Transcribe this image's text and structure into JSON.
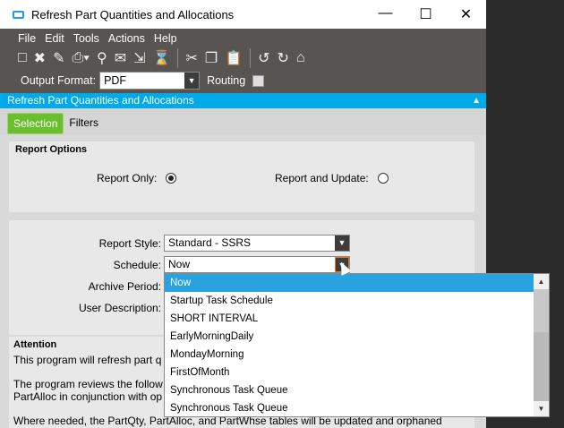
{
  "window": {
    "title": "Refresh Part Quantities and Allocations"
  },
  "menu": [
    "File",
    "Edit",
    "Tools",
    "Actions",
    "Help"
  ],
  "toolbar": {
    "icons": [
      "new-icon",
      "delete-icon",
      "clear-icon",
      "print-icon",
      "print-preview-icon",
      "email-icon",
      "submit-icon",
      "schedule-icon",
      "cut-icon",
      "copy-icon",
      "paste-icon",
      "back-icon",
      "forward-icon",
      "home-icon"
    ]
  },
  "output": {
    "label": "Output Format:",
    "value": "PDF",
    "routing_label": "Routing"
  },
  "panel_title": "Refresh Part Quantities and Allocations",
  "tabs": [
    "Selection",
    "Filters"
  ],
  "report_options": {
    "title": "Report Options",
    "report_only": "Report Only:",
    "report_update": "Report and Update:"
  },
  "form": {
    "style_label": "Report Style:",
    "style_value": "Standard - SSRS",
    "schedule_label": "Schedule:",
    "schedule_value": "Now",
    "archive_label": "Archive Period:",
    "desc_label": "User Description:"
  },
  "dropdown": [
    "Now",
    "Startup Task Schedule",
    "SHORT INTERVAL",
    "EarlyMorningDaily",
    "MondayMorning",
    "FirstOfMonth",
    "Synchronous Task Queue",
    "Synchronous Task Queue"
  ],
  "attention": {
    "title": "Attention",
    "p1": "This program will refresh part q",
    "p2a": "The program reviews the follow",
    "p2b": "PartAlloc in conjunction with op",
    "p3": "Where needed, the PartQty, PartAlloc, and PartWhse tables will be updated and orphaned"
  },
  "colors": {
    "accent": "#00a9ea",
    "tab_active": "#6abf2e",
    "highlight": "#29a3e0"
  }
}
